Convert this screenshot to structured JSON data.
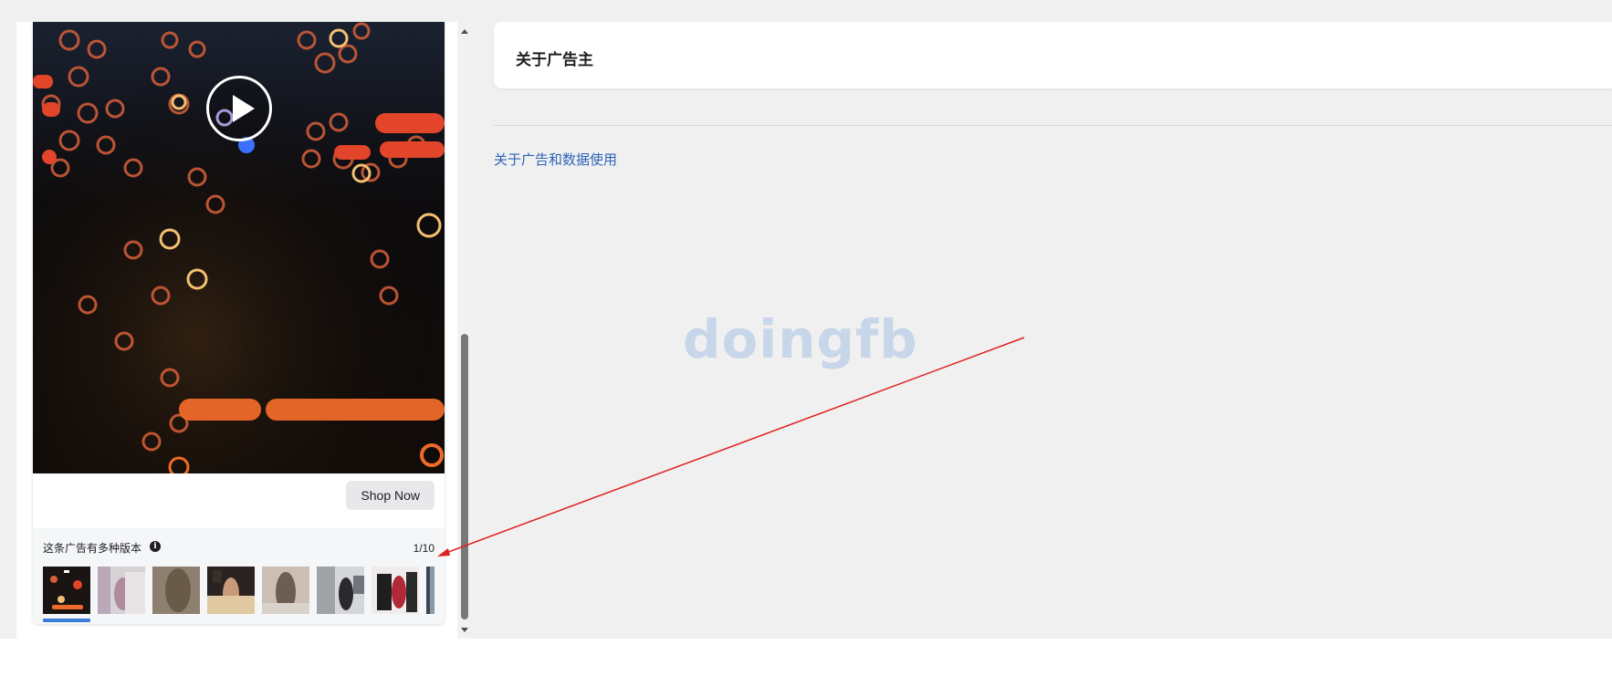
{
  "ad": {
    "shop_now_label": "Shop Now",
    "versions_label": "这条广告有多种版本",
    "versions_count": "1/10",
    "thumbnails": [
      "version-1",
      "version-2",
      "version-3",
      "version-4",
      "version-5",
      "version-6",
      "version-7",
      "version-8"
    ]
  },
  "advertiser": {
    "title": "关于广告主"
  },
  "links": {
    "ad_data_usage": "关于广告和数据使用"
  },
  "watermark": "doingfb",
  "colors": {
    "link": "#2c64b8",
    "annotation_arrow": "#e02020",
    "active_thumb_underline": "#3b7fd9"
  }
}
